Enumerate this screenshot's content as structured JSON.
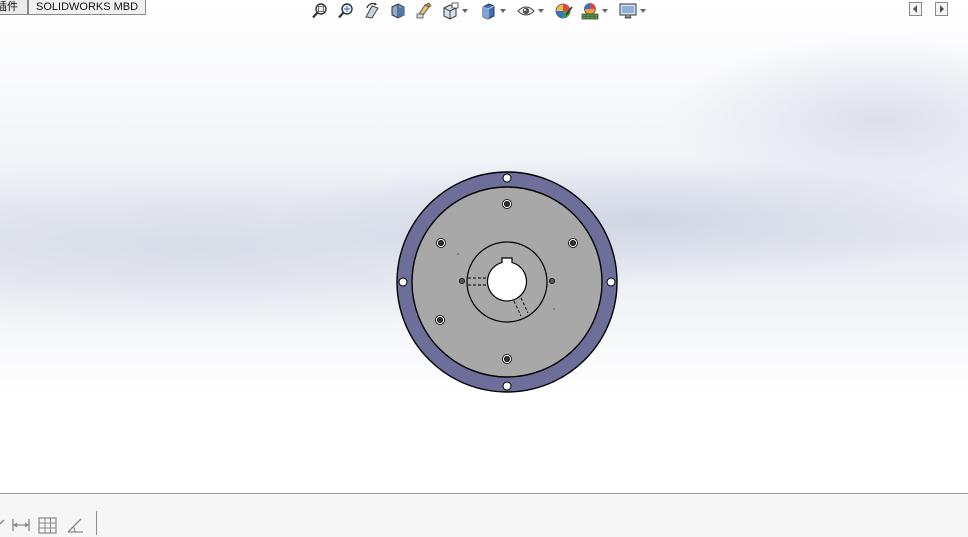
{
  "tabs": [
    {
      "label": "插件"
    },
    {
      "label": "SOLIDWORKS MBD"
    }
  ],
  "toolbar": {
    "icons": [
      "zoom-to-fit-icon",
      "zoom-to-area-icon",
      "previous-view-icon",
      "section-view-icon",
      "dynamic-annotation-icon",
      "view-orientation-icon",
      "display-style-icon",
      "hide-show-items-icon",
      "edit-appearance-icon",
      "apply-scene-icon",
      "view-settings-icon"
    ]
  },
  "colors": {
    "flange_ring": "#6e6e9a",
    "plate": "#a8a8a8",
    "outline": "#000000"
  }
}
